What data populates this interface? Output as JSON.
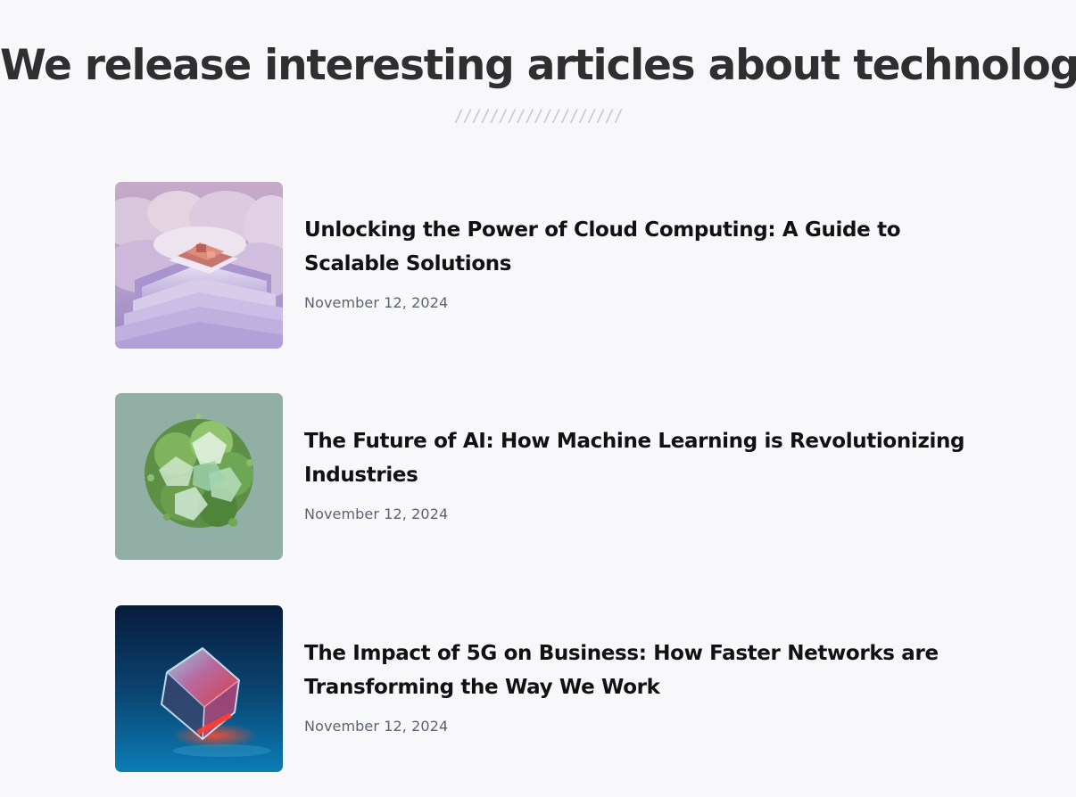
{
  "header": {
    "title": "We release interesting articles about technology",
    "divider": "///////////////////"
  },
  "articles": [
    {
      "title": "Unlocking the Power of Cloud Computing: A Guide to Scalable Solutions",
      "date": "November 12, 2024",
      "image": "cloud-computing-thumbnail"
    },
    {
      "title": "The Future of AI: How Machine Learning is Revolutionizing Industries",
      "date": "November 12, 2024",
      "image": "ai-machine-learning-thumbnail"
    },
    {
      "title": "The Impact of 5G on Business: How Faster Networks are Transforming the Way We Work",
      "date": "November 12, 2024",
      "image": "5g-networks-thumbnail"
    }
  ],
  "colors": {
    "background": "#f8f8fb",
    "heading": "#2f2f2f",
    "article_title": "#111111",
    "date": "#5c6370",
    "divider": "#c9c9cc"
  }
}
